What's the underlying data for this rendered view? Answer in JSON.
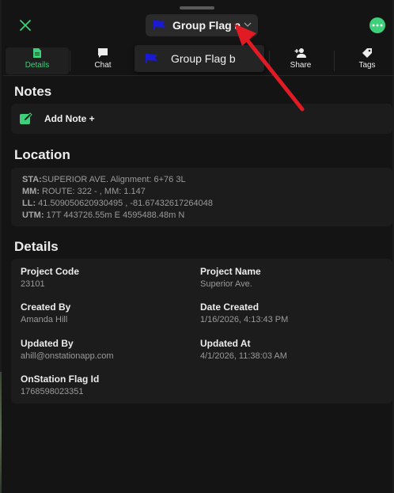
{
  "header": {
    "group_select_label": "Group Flag a",
    "dropdown_option": "Group Flag b",
    "flag_color": "#1a1ad6",
    "accent_color": "#3ecf7a",
    "close_icon": "close-icon",
    "more_icon": "more-icon"
  },
  "tabs": [
    {
      "label": "Details",
      "icon": "document-icon",
      "active": true
    },
    {
      "label": "Chat",
      "icon": "chat-icon",
      "active": false
    },
    {
      "label": "Share",
      "icon": "add-user-icon",
      "active": false
    },
    {
      "label": "Tags",
      "icon": "tag-icon",
      "active": false
    }
  ],
  "notes": {
    "title": "Notes",
    "add_label": "Add Note +"
  },
  "location": {
    "title": "Location",
    "sta_label": "STA:",
    "sta_value": "SUPERIOR AVE. Alignment: 6+76 3L",
    "mm_label": "MM:",
    "mm_value": " ROUTE: 322 - , MM: 1.147",
    "ll_label": "LL:",
    "ll_value": " 41.509050620930495 , -81.67432617264048",
    "utm_label": "UTM:",
    "utm_value": " 17T 443726.55m E 4595488.48m N"
  },
  "details": {
    "title": "Details",
    "fields": [
      {
        "key": "Project Code",
        "value": "23101"
      },
      {
        "key": "Project Name",
        "value": "Superior Ave."
      },
      {
        "key": "Created By",
        "value": "Amanda Hill"
      },
      {
        "key": "Date Created",
        "value": "1/16/2026, 4:13:43 PM"
      },
      {
        "key": "Updated By",
        "value": "ahill@onstationapp.com"
      },
      {
        "key": "Updated At",
        "value": "4/1/2026, 11:38:03 AM"
      },
      {
        "key": "OnStation Flag Id",
        "value": "1768598023351"
      }
    ]
  }
}
